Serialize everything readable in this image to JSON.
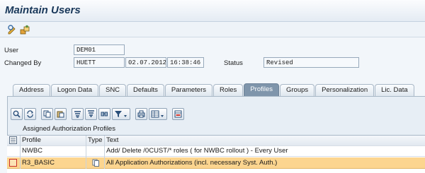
{
  "window": {
    "title": "Maintain Users"
  },
  "toolbar": {
    "icons": [
      "display-change-icon",
      "other-user-icon"
    ]
  },
  "header": {
    "user_label": "User",
    "user_value": "DEM01",
    "changed_by_label": "Changed By",
    "changed_by_value": "HUETT",
    "date_value": "02.07.2012",
    "time_value": "16:38:46",
    "status_label": "Status",
    "status_value": "Revised"
  },
  "tabs": [
    {
      "label": "Address",
      "active": false
    },
    {
      "label": "Logon Data",
      "active": false
    },
    {
      "label": "SNC",
      "active": false
    },
    {
      "label": "Defaults",
      "active": false
    },
    {
      "label": "Parameters",
      "active": false
    },
    {
      "label": "Roles",
      "active": false
    },
    {
      "label": "Profiles",
      "active": true
    },
    {
      "label": "Groups",
      "active": false
    },
    {
      "label": "Personalization",
      "active": false
    },
    {
      "label": "Lic. Data",
      "active": false
    }
  ],
  "grid": {
    "toolbar_icons": [
      "details-icon",
      "refresh-icon",
      "copy-icon",
      "paste-icon",
      "sort-ascending-icon",
      "filter-icon",
      "find-icon",
      "filter-dropdown-icon",
      "print-icon",
      "layout-icon",
      "delete-row-icon"
    ],
    "caption": "Assigned Authorization Profiles",
    "columns": {
      "profile": "Profile",
      "type": "Type",
      "text": "Text"
    },
    "rows": [
      {
        "profile": "NWBC",
        "type": "",
        "text": "Add/ Delete /0CUST/* roles ( for NWBC rollout ) - Every User",
        "selected": false
      },
      {
        "profile": "R3_BASIC",
        "type": "composite-profile-icon",
        "text": "All Application Authorizations (incl. necessary Syst. Auth.)",
        "selected": true
      }
    ]
  },
  "colors": {
    "title": "#19385a",
    "active_tab": "#7f95ab",
    "selected_row": "#fcd58f"
  }
}
